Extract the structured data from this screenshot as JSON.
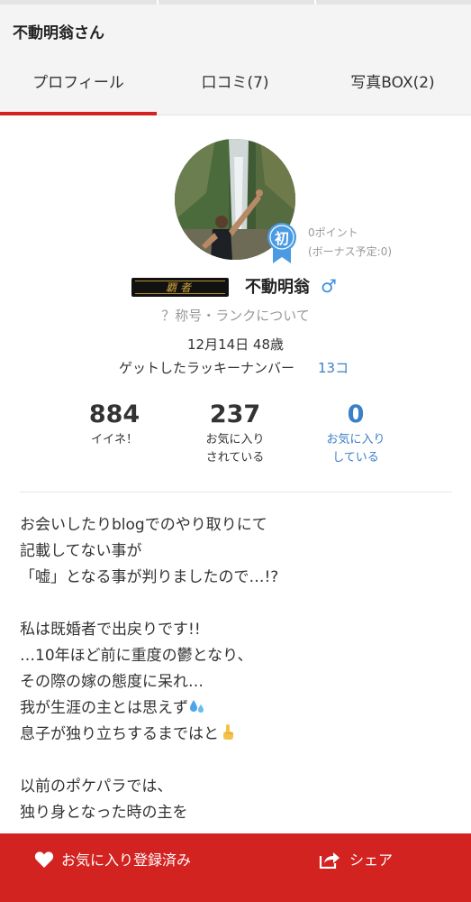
{
  "header": {
    "title": "不動明翁さん"
  },
  "tabs": [
    {
      "label": "プロフィール",
      "active": true
    },
    {
      "label": "口コミ(7)",
      "active": false
    },
    {
      "label": "写真BOX(2)",
      "active": false
    }
  ],
  "profile": {
    "badge_label": "初",
    "points": "0ポイント",
    "bonus": "(ボーナス予定:0)",
    "rank_title": "覇者",
    "name": "不動明翁",
    "gender_symbol": "♂",
    "rank_link": "？称号・ランクについて",
    "birth": "12月14日 48歳",
    "lucky_label": "ゲットしたラッキーナンバー",
    "lucky_count": "13コ"
  },
  "stats": [
    {
      "value": "884",
      "label1": "イイネ！",
      "label2": ""
    },
    {
      "value": "237",
      "label1": "お気に入り",
      "label2": "されている"
    },
    {
      "value": "0",
      "label1": "お気に入り",
      "label2": "している"
    }
  ],
  "bio": {
    "lines": [
      "お会いしたりblogでのやり取りにて",
      "記載してない事が",
      "「嘘」となる事が判りましたので…!?",
      "",
      "私は既婚者で出戻りです!!",
      "…10年ほど前に重度の鬱となり、",
      "その際の嫁の態度に呆れ…",
      "我が生涯の主とは思えず",
      "息子が独り立ちするまではと",
      "",
      "以前のポケパラでは、",
      "独り身となった時の主を"
    ]
  },
  "bottom": {
    "favorite_label": "お気に入り登録済み",
    "share_label": "シェア"
  },
  "colors": {
    "accent_red": "#d32321",
    "link_blue": "#3a80c8",
    "gender_blue": "#3a8fe0",
    "header_bg": "#f4f4f4"
  },
  "icons": {
    "gender": "male-symbol-icon",
    "favorite": "heart-icon",
    "share": "share-icon",
    "sweat": "sweat-droplets-icon",
    "pointing": "pointing-up-icon"
  }
}
